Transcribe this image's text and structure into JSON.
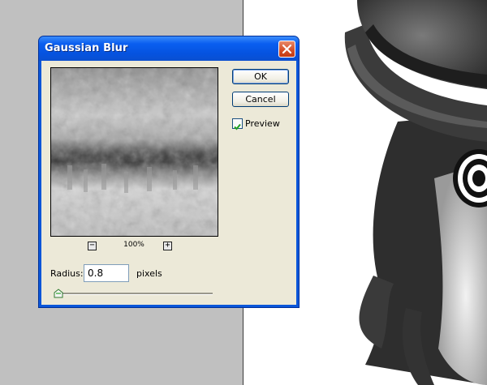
{
  "dialog": {
    "title": "Gaussian Blur",
    "ok_label": "OK",
    "cancel_label": "Cancel",
    "preview_label": "Preview",
    "preview_checked": true,
    "zoom_level": "100%",
    "zoom_out_symbol": "−",
    "zoom_in_symbol": "+",
    "radius_label": "Radius:",
    "radius_value": "0.8",
    "radius_units": "pixels",
    "slider_fraction": 0.01
  },
  "icons": {
    "close": "close-icon",
    "check": "checkmark-icon",
    "slider": "slider-thumb-icon"
  },
  "colors": {
    "titlebar": "#0a5ef0",
    "close_button": "#d5512a",
    "dialog_face": "#ece9d8",
    "app_background": "#c0c0c0"
  }
}
